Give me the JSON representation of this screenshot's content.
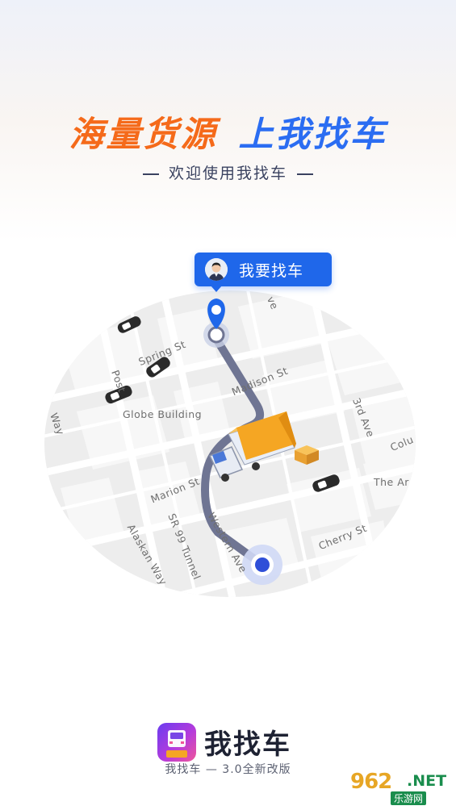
{
  "header": {
    "headline_a": "海量货源",
    "headline_b": "上我找车",
    "subtitle": "欢迎使用我找车"
  },
  "map": {
    "bubble_label": "我要找车",
    "streets": [
      "Spring St",
      "Madison St",
      "Globe Building",
      "3rd Ave",
      "Marion St",
      "Colu",
      "The Ar",
      "SR 99 Tunnel",
      "Western Ave",
      "Alaskan Way",
      "Cherry St",
      "Post",
      "ve",
      "Way"
    ]
  },
  "brand": {
    "name": "我找车",
    "tagline": "我找车 — 3.0全新改版"
  },
  "watermark": {
    "top": "962",
    "net": ".NET",
    "bottom": "乐游网"
  },
  "colors": {
    "headline_orange": "#f56a1a",
    "headline_blue": "#2b6df2",
    "route_blue": "#1f67ea",
    "route_gray": "#6f7593",
    "truck_orange": "#f5a623"
  }
}
